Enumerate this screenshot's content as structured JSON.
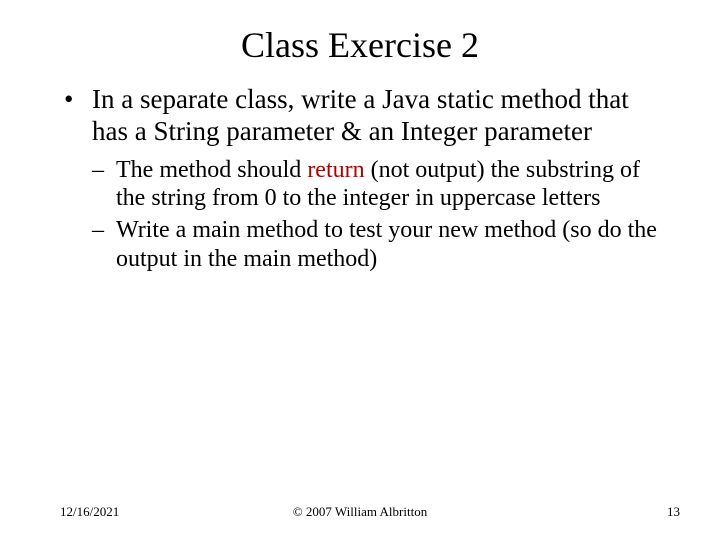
{
  "title": "Class Exercise 2",
  "body": {
    "bullet1": "In a separate class, write a Java static method that has a String parameter & an Integer parameter",
    "sub1_prefix": "The method should ",
    "sub1_return": "return",
    "sub1_suffix": " (not output) the substring of the string from 0 to the integer in uppercase letters",
    "sub2": "Write a main method to test your new method (so do the output in the main method)"
  },
  "footer": {
    "date": "12/16/2021",
    "copyright": "© 2007 William Albritton",
    "page": "13"
  },
  "markers": {
    "dot": "•",
    "dash": "–"
  }
}
